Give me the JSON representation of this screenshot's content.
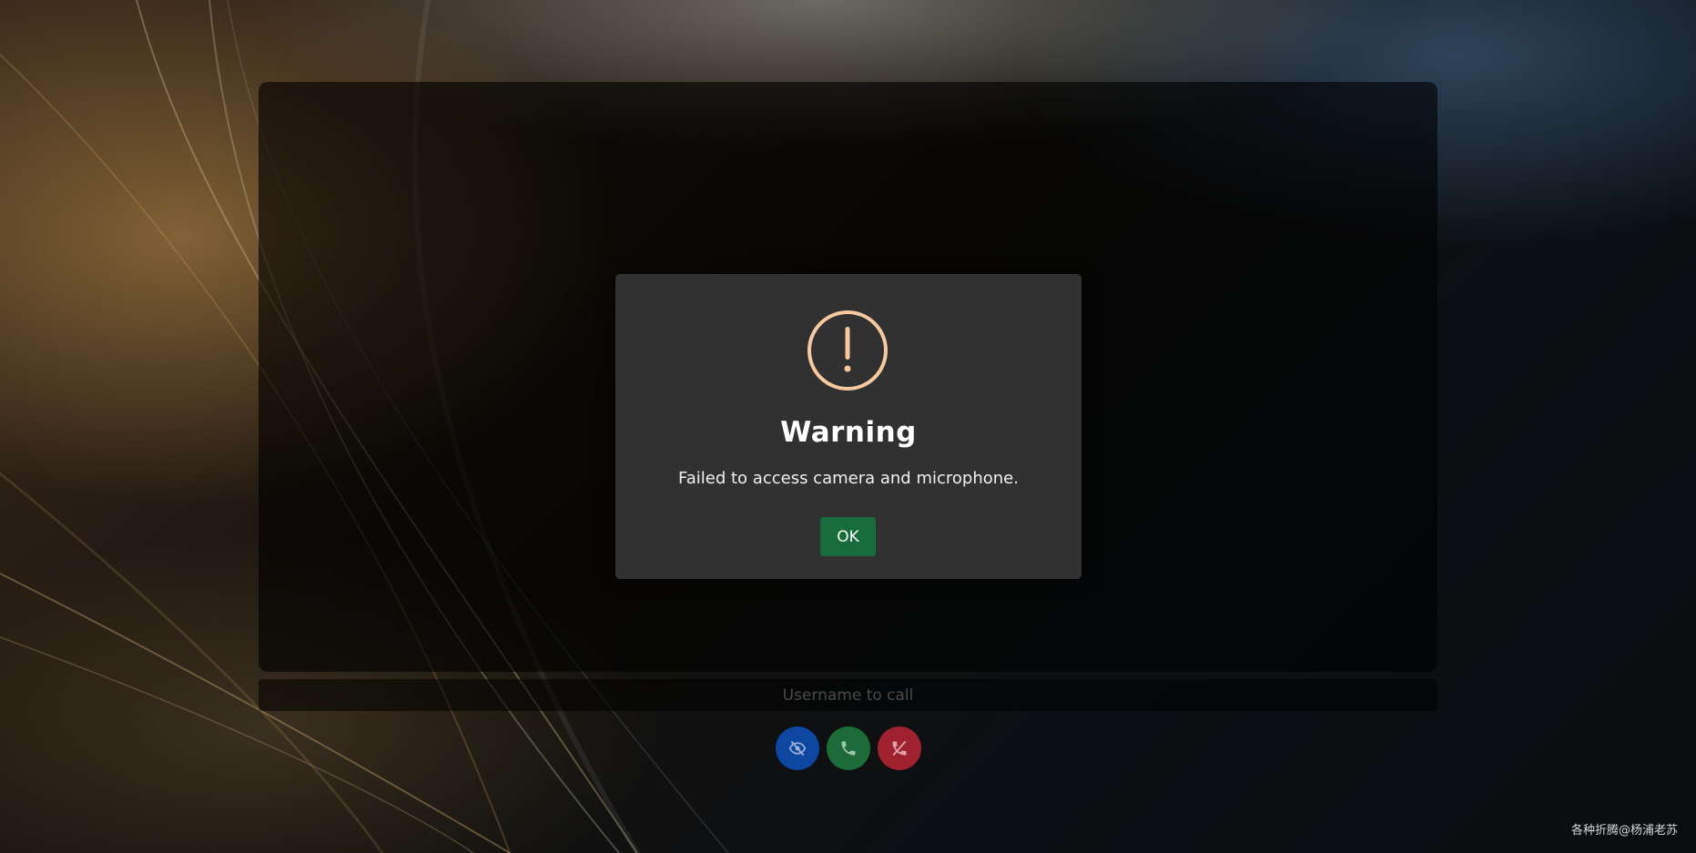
{
  "call": {
    "username_placeholder": "Username to call"
  },
  "controls": [
    {
      "id": "toggle-video",
      "icon": "eye-slash-icon",
      "color": "#0d47a1"
    },
    {
      "id": "call",
      "icon": "phone-icon",
      "color": "#1e6b3a"
    },
    {
      "id": "hangup",
      "icon": "phone-slash-icon",
      "color": "#a0222f"
    }
  ],
  "dialog": {
    "icon": "warning-icon",
    "icon_color": "#f8c99f",
    "title": "Warning",
    "message": "Failed to access camera and microphone.",
    "ok_label": "OK",
    "ok_color": "#186b3d"
  },
  "watermark": "各种折腾@杨浦老苏"
}
